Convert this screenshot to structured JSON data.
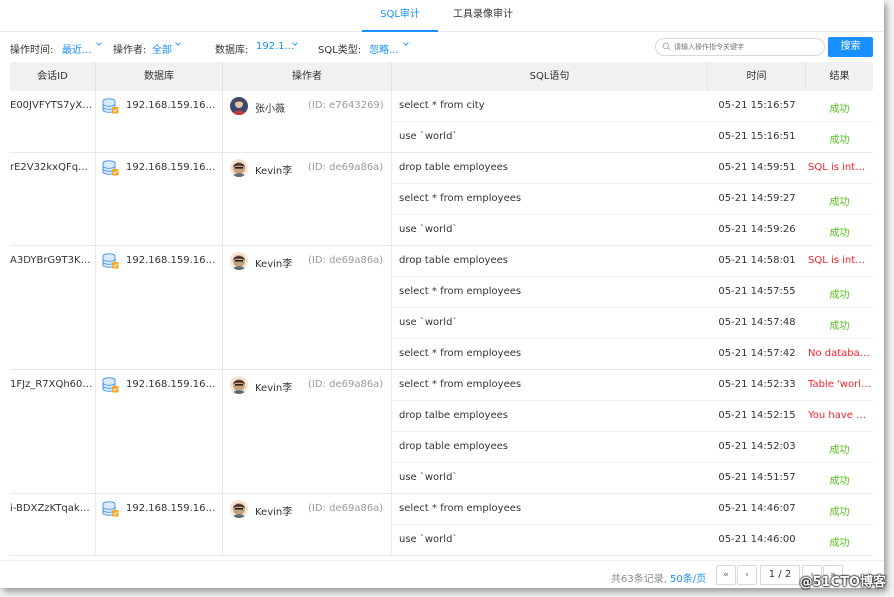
{
  "tabs": [
    {
      "label": "SQL审计",
      "active": true
    },
    {
      "label": "工具录像审计",
      "active": false
    }
  ],
  "filters": {
    "time_label": "操作时间:",
    "time_value": "最近...",
    "operator_label": "操作者:",
    "operator_value": "全部",
    "db_label": "数据库:",
    "db_value": "192.1...",
    "sqltype_label": "SQL类型:",
    "sqltype_value": "忽略...",
    "search_placeholder": "请输入操作指令关键字",
    "search_button": "搜索"
  },
  "columns": [
    "会话ID",
    "数据库",
    "操作者",
    "SQL语句",
    "时间",
    "结果"
  ],
  "colors": {
    "accent": "#1890ff",
    "success": "#52c41a",
    "error": "#f5222d"
  },
  "groups": [
    {
      "session": "E00JVFYTS7yXZ...",
      "db": "192.168.159.167:...",
      "operator": "张小薇",
      "operator_id": "(ID: e7643269)",
      "rows": [
        {
          "sql": "select * from city",
          "time": "05-21 15:16:57",
          "result": "成功",
          "ok": true
        },
        {
          "sql": "use `world`",
          "time": "05-21 15:16:51",
          "result": "成功",
          "ok": true
        }
      ]
    },
    {
      "session": "rE2V32kxQFqUf...",
      "db": "192.168.159.167:...",
      "operator": "Kevin李",
      "operator_id": "(ID: de69a86a)",
      "rows": [
        {
          "sql": "drop table employees",
          "time": "05-21 14:59:51",
          "result": "SQL is interc...",
          "ok": false
        },
        {
          "sql": "select * from employees",
          "time": "05-21 14:59:27",
          "result": "成功",
          "ok": true
        },
        {
          "sql": "use `world`",
          "time": "05-21 14:59:26",
          "result": "成功",
          "ok": true
        }
      ]
    },
    {
      "session": "A3DYBrG9T3K2P...",
      "db": "192.168.159.167:...",
      "operator": "Kevin李",
      "operator_id": "(ID: de69a86a)",
      "rows": [
        {
          "sql": "drop table employees",
          "time": "05-21 14:58:01",
          "result": "SQL is interc...",
          "ok": false
        },
        {
          "sql": "select * from employees",
          "time": "05-21 14:57:55",
          "result": "成功",
          "ok": true
        },
        {
          "sql": "use `world`",
          "time": "05-21 14:57:48",
          "result": "成功",
          "ok": true
        },
        {
          "sql": "select * from employees",
          "time": "05-21 14:57:42",
          "result": "No database...",
          "ok": false
        }
      ]
    },
    {
      "session": "1FJz_R7XQh60rL...",
      "db": "192.168.159.167:...",
      "operator": "Kevin李",
      "operator_id": "(ID: de69a86a)",
      "rows": [
        {
          "sql": "select * from employees",
          "time": "05-21 14:52:33",
          "result": "Table 'world....",
          "ok": false
        },
        {
          "sql": "drop talbe employees",
          "time": "05-21 14:52:15",
          "result": "You have an ...",
          "ok": false
        },
        {
          "sql": "drop table employees",
          "time": "05-21 14:52:03",
          "result": "成功",
          "ok": true
        },
        {
          "sql": "use `world`",
          "time": "05-21 14:51:57",
          "result": "成功",
          "ok": true
        }
      ]
    },
    {
      "session": "i-BDXZzKTqakm...",
      "db": "192.168.159.167:...",
      "operator": "Kevin李",
      "operator_id": "(ID: de69a86a)",
      "rows": [
        {
          "sql": "select * from employees",
          "time": "05-21 14:46:07",
          "result": "成功",
          "ok": true
        },
        {
          "sql": "use `world`",
          "time": "05-21 14:46:00",
          "result": "成功",
          "ok": true
        }
      ]
    }
  ],
  "pager": {
    "total": "共63条记录,",
    "page_size": "50条/页",
    "first": "«",
    "prev": "‹",
    "page": "1 / 2",
    "next": "›",
    "last": "»"
  },
  "watermark": "@51CTO博客"
}
